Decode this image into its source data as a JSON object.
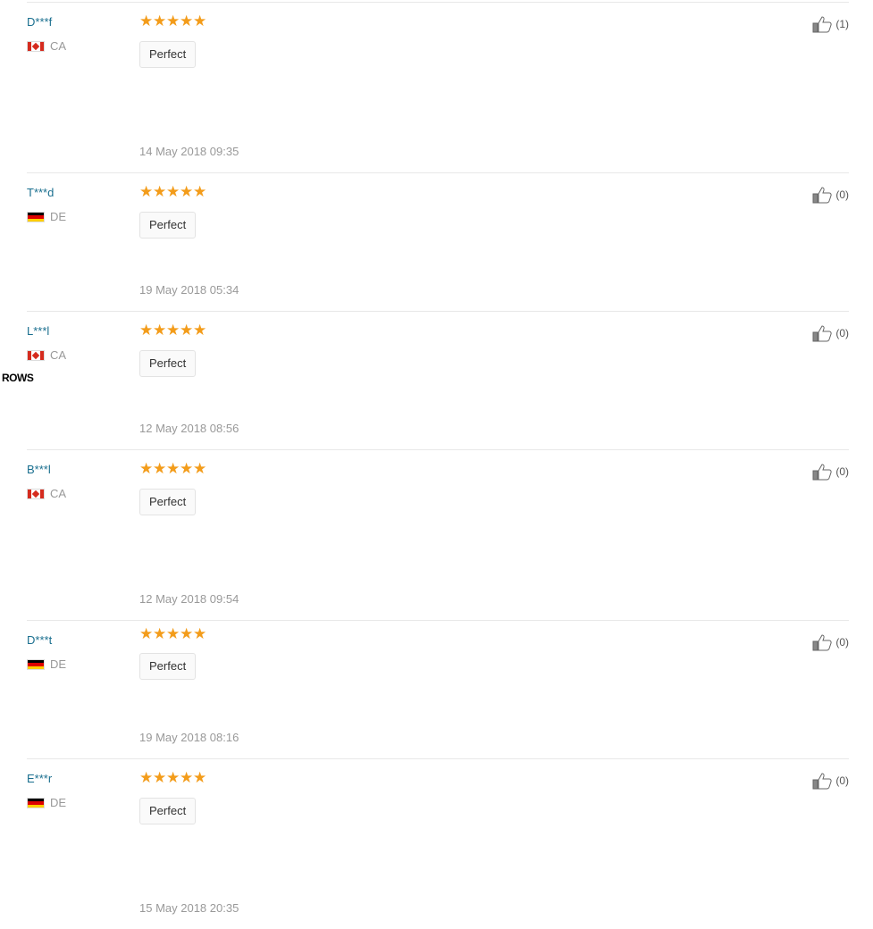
{
  "reviews": [
    {
      "user": "D***f",
      "country": "CA",
      "flag": "ca",
      "tag": "Perfect",
      "date": "14 May 2018 09:35",
      "likes": "(1)",
      "rating": 5
    },
    {
      "user": "T***d",
      "country": "DE",
      "flag": "de",
      "tag": "Perfect",
      "date": "19 May 2018 05:34",
      "likes": "(0)",
      "rating": 5
    },
    {
      "user": "L***l",
      "country": "CA",
      "flag": "ca",
      "tag": "Perfect",
      "date": "12 May 2018 08:56",
      "likes": "(0)",
      "rating": 5
    },
    {
      "user": "B***l",
      "country": "CA",
      "flag": "ca",
      "tag": "Perfect",
      "date": "12 May 2018 09:54",
      "likes": "(0)",
      "rating": 5
    },
    {
      "user": "D***t",
      "country": "DE",
      "flag": "de",
      "tag": "Perfect",
      "date": "19 May 2018 08:16",
      "likes": "(0)",
      "rating": 5
    },
    {
      "user": "E***r",
      "country": "DE",
      "flag": "de",
      "tag": "Perfect",
      "date": "15 May 2018 20:35",
      "likes": "(0)",
      "rating": 5
    }
  ],
  "overlay_label": "ROWS",
  "colors": {
    "star": "#f39c1a",
    "user_link": "#1a6f8f",
    "meta_text": "#999999"
  },
  "icons": {
    "rating": "star-icon",
    "like": "thumbs-up-icon"
  }
}
